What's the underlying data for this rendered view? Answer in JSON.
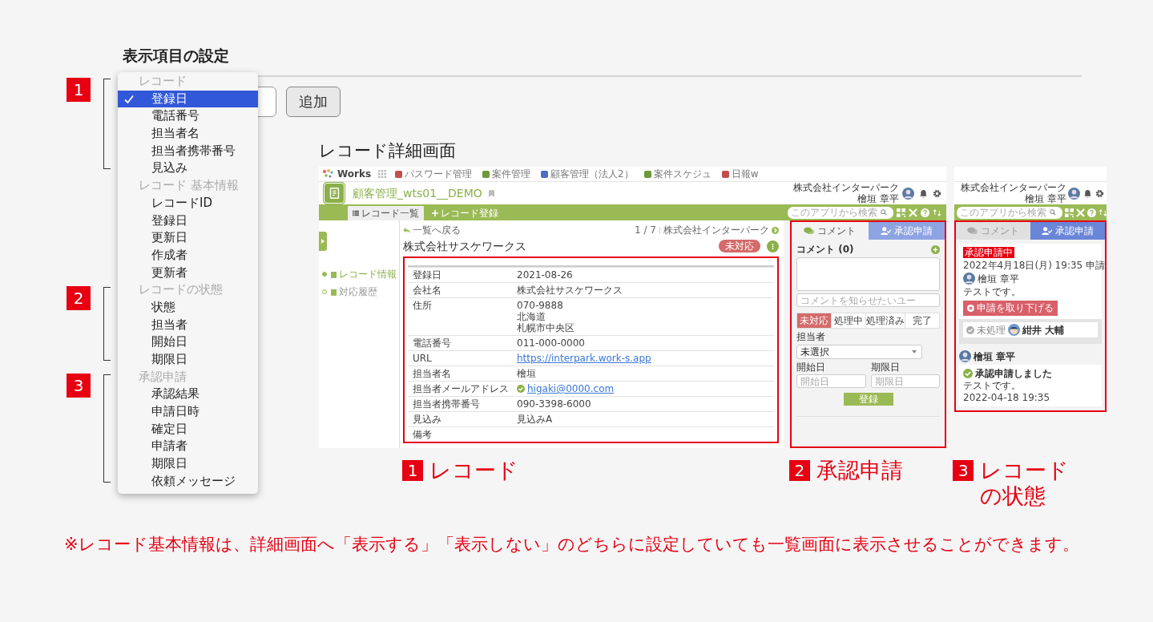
{
  "settings": {
    "title": "表示項目の設定",
    "add_button": "追加"
  },
  "menu": {
    "groups": [
      {
        "label": "レコード",
        "callout": "1",
        "items": [
          {
            "label": "登録日",
            "selected": true
          },
          {
            "label": "電話番号",
            "selected": false
          },
          {
            "label": "担当者名",
            "selected": false
          },
          {
            "label": "担当者携帯番号",
            "selected": false
          },
          {
            "label": "見込み",
            "selected": false
          }
        ]
      },
      {
        "label": "レコード 基本情報",
        "items": [
          {
            "label": "レコードID",
            "selected": false
          },
          {
            "label": "登録日",
            "selected": false
          },
          {
            "label": "更新日",
            "selected": false
          },
          {
            "label": "作成者",
            "selected": false
          },
          {
            "label": "更新者",
            "selected": false
          }
        ]
      },
      {
        "label": "レコードの状態",
        "callout": "2",
        "items": [
          {
            "label": "状態",
            "selected": false
          },
          {
            "label": "担当者",
            "selected": false
          },
          {
            "label": "開始日",
            "selected": false
          },
          {
            "label": "期限日",
            "selected": false
          }
        ]
      },
      {
        "label": "承認申請",
        "callout": "3",
        "items": [
          {
            "label": "承認結果",
            "selected": false
          },
          {
            "label": "申請日時",
            "selected": false
          },
          {
            "label": "確定日",
            "selected": false
          },
          {
            "label": "申請者",
            "selected": false
          },
          {
            "label": "期限日",
            "selected": false
          },
          {
            "label": "依頼メッセージ",
            "selected": false
          }
        ]
      }
    ]
  },
  "detail_heading": "レコード詳細画面",
  "app": {
    "logo": "Works",
    "apps": [
      {
        "label": "パスワード管理",
        "color": "#c0504d"
      },
      {
        "label": "案件管理",
        "color": "#6a9a3a"
      },
      {
        "label": "顧客管理（法人2）",
        "color": "#4a6fc0"
      },
      {
        "label": "案件スケジュ",
        "color": "#6a9a3a"
      },
      {
        "label": "日報w",
        "color": "#c0504d"
      }
    ],
    "title": "顧客管理_wts01__DEMO",
    "tabs": [
      {
        "label": "レコード一覧",
        "selected": true
      },
      {
        "label": "レコード登録",
        "selected": false
      }
    ],
    "company": "株式会社インターパーク",
    "user": "檜垣 章平",
    "search_placeholder": "このアプリから検索"
  },
  "record": {
    "sidebar": [
      {
        "label": "レコード情報",
        "selected": true
      },
      {
        "label": "対応履歴",
        "selected": false
      }
    ],
    "back_link": "一覧へ戻る",
    "pager": "1 / 7",
    "next_record": "株式会社インターパーク",
    "title": "株式会社サスケワークス",
    "status": "未対応",
    "fields": [
      {
        "label": "登録日",
        "kind": "text",
        "value": "2021-08-26"
      },
      {
        "label": "会社名",
        "kind": "text",
        "value": "株式会社サスケワークス"
      },
      {
        "label": "住所",
        "kind": "lines",
        "lines": [
          "070-9888",
          "北海道",
          "札幌市中央区"
        ]
      },
      {
        "label": "電話番号",
        "kind": "text",
        "value": "011-000-0000"
      },
      {
        "label": "URL",
        "kind": "link",
        "value": "https://interpark.work-s.app"
      },
      {
        "label": "担当者名",
        "kind": "text",
        "value": "檜垣"
      },
      {
        "label": "担当者メールアドレス",
        "kind": "verified_link",
        "value": "higaki@0000.com"
      },
      {
        "label": "担当者携帯番号",
        "kind": "text",
        "value": "090-3398-6000"
      },
      {
        "label": "見込み",
        "kind": "text",
        "value": "見込みA"
      },
      {
        "label": "備考",
        "kind": "empty"
      }
    ]
  },
  "comment_panel": {
    "tabs": [
      {
        "label": "コメント",
        "kind": "comment",
        "selected": true
      },
      {
        "label": "承認申請",
        "kind": "approval",
        "selected": false
      }
    ],
    "heading": "コメント (0)",
    "mention_placeholder": "コメントを知らせたいユー",
    "statuses": [
      {
        "label": "未対応",
        "selected": true
      },
      {
        "label": "処理中",
        "selected": false
      },
      {
        "label": "処理済み",
        "selected": false
      },
      {
        "label": "完了",
        "selected": false
      }
    ],
    "assignee_label": "担当者",
    "assignee_value": "未選択",
    "start_label": "開始日",
    "start_placeholder": "開始日",
    "due_label": "期限日",
    "due_placeholder": "期限日",
    "submit": "登録"
  },
  "approval_screen": {
    "company": "株式会社インターパーク",
    "user": "檜垣 章平",
    "search_placeholder": "このアプリから検索",
    "tabs": [
      {
        "label": "コメント",
        "kind": "comment",
        "selected": false
      },
      {
        "label": "承認申請",
        "kind": "approval",
        "selected": true
      }
    ],
    "request": {
      "badge": "承認申請中",
      "date": "2022年4月18日(月) 19:35 申請",
      "user": "檜垣 章平",
      "message": "テストです。",
      "withdraw_button": "申請を取り下げる",
      "approver_status": "未処理",
      "approver": "紺井 大輔"
    },
    "history": {
      "user": "檜垣 章平",
      "action": "承認申請しました",
      "message": "テストです。",
      "date": "2022-04-18 19:35"
    }
  },
  "captions": [
    {
      "number": "1",
      "text": "レコード"
    },
    {
      "number": "2",
      "text": "承認申請"
    },
    {
      "number": "3",
      "text": "レコードの状態"
    }
  ],
  "note": "※レコード基本情報は、詳細画面へ「表示する」「表示しない」のどちらに設定していても一覧画面に表示させることができます。"
}
